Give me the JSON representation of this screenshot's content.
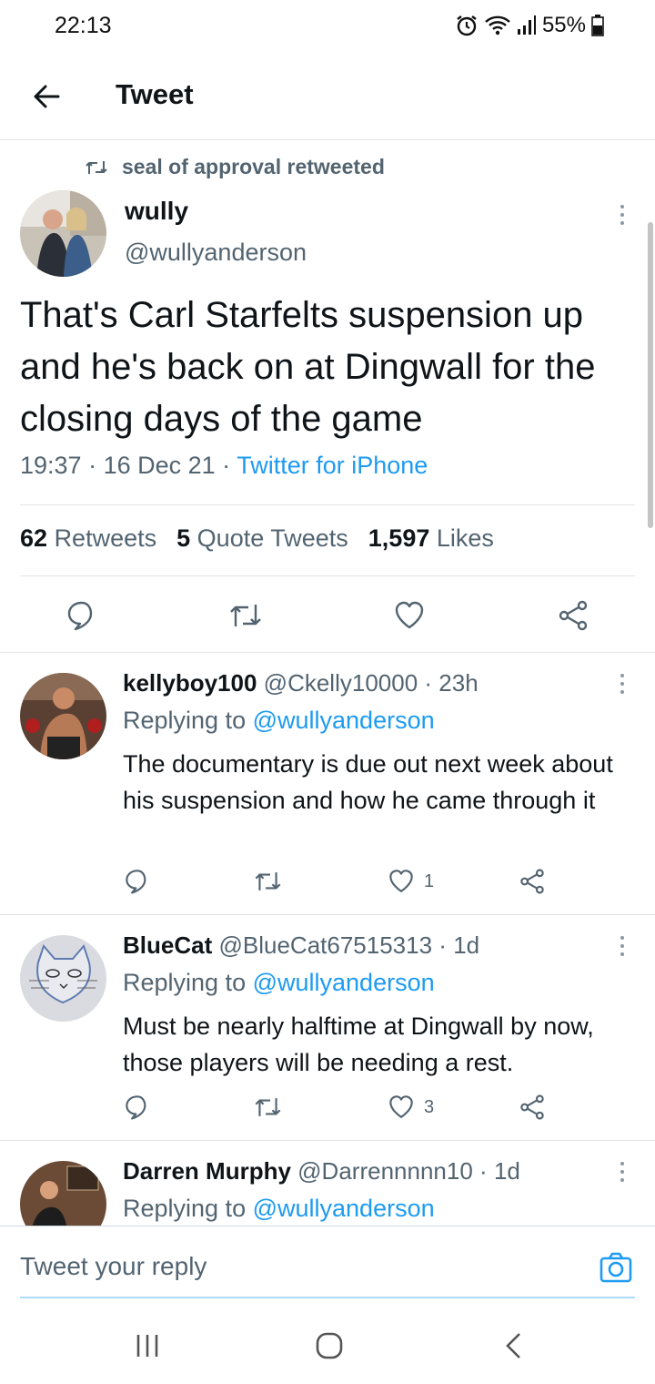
{
  "status_bar": {
    "time": "22:13",
    "battery": "55%",
    "icons": [
      "alarm-icon",
      "wifi-icon",
      "signal-icon",
      "battery-icon"
    ]
  },
  "header": {
    "back_icon": "arrow-left-icon",
    "title": "Tweet"
  },
  "main_tweet": {
    "retweeted_by": "seal of approval retweeted",
    "author_name": "wully",
    "author_handle": "@wullyanderson",
    "text": "That's Carl Starfelts suspension up and he's back on at Dingwall for the closing days of the game",
    "time": "19:37",
    "date": "16 Dec 21",
    "source": "Twitter for iPhone",
    "retweets_count": "62",
    "retweets_label": "Retweets",
    "quotes_count": "5",
    "quotes_label": "Quote Tweets",
    "likes_count": "1,597",
    "likes_label": "Likes"
  },
  "replies": [
    {
      "name": "kellyboy100",
      "handle": "@Ckelly10000",
      "time": "23h",
      "replying_prefix": "Replying to",
      "replying_to": "@wullyanderson",
      "text": "The documentary is due out next week about his suspension and how he came through it",
      "likes": "1"
    },
    {
      "name": "BlueCat",
      "handle": "@BlueCat67515313",
      "time": "1d",
      "replying_prefix": "Replying to",
      "replying_to": "@wullyanderson",
      "text": "Must be nearly halftime at Dingwall by now,  those players will be needing a rest.",
      "likes": "3"
    },
    {
      "name": "Darren Murphy",
      "handle": "@Darrennnnn10",
      "time": "1d",
      "replying_prefix": "Replying to",
      "replying_to": "@wullyanderson"
    }
  ],
  "reply_bar": {
    "placeholder": "Tweet your reply",
    "camera_icon": "camera-icon"
  },
  "colors": {
    "accent": "#1d9bf0",
    "text": "#0f1419",
    "muted": "#536471",
    "divider": "#e1e4e6"
  }
}
